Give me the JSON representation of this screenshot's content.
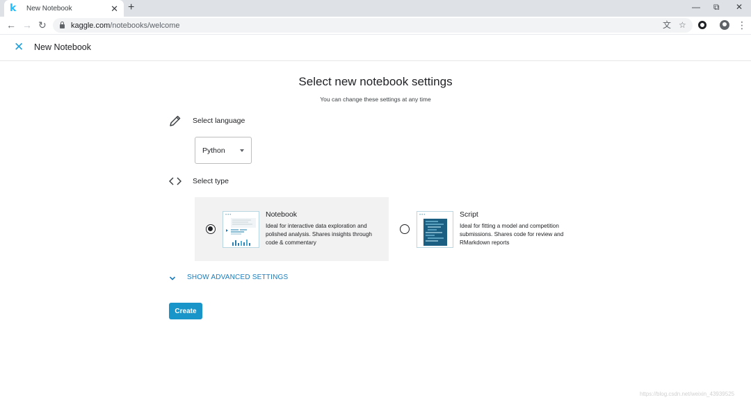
{
  "browser": {
    "tab_title": "New Notebook",
    "tab_favicon": "k",
    "tab_close": "✕",
    "new_tab": "+",
    "url_host": "kaggle.com",
    "url_path": "/notebooks/welcome",
    "icons": [
      "back-icon",
      "forward-icon",
      "reload-icon",
      "lock-icon",
      "translate-icon",
      "star-icon",
      "extension-icon",
      "profile-icon",
      "menu-icon"
    ]
  },
  "header": {
    "close_icon": "✕",
    "title": "New Notebook"
  },
  "main": {
    "title": "Select new notebook settings",
    "subtitle": "You can change these settings at any time",
    "language": {
      "label": "Select language",
      "selected": "Python"
    },
    "type": {
      "label": "Select type",
      "options": [
        {
          "name": "Notebook",
          "description": "Ideal for interactive data exploration and polished analysis. Shares insights through code & commentary",
          "selected": true
        },
        {
          "name": "Script",
          "description": "Ideal for fitting a model and competition submissions. Shares code for review and RMarkdown reports",
          "selected": false
        }
      ]
    },
    "advanced_label": "SHOW ADVANCED SETTINGS",
    "create_label": "Create"
  },
  "watermark": "https://blog.csdn.net/weixin_43939525",
  "colors": {
    "accent": "#20a0d8",
    "link": "#1a7cbd",
    "button": "#1995c9",
    "selected_card": "#f2f2f2"
  }
}
